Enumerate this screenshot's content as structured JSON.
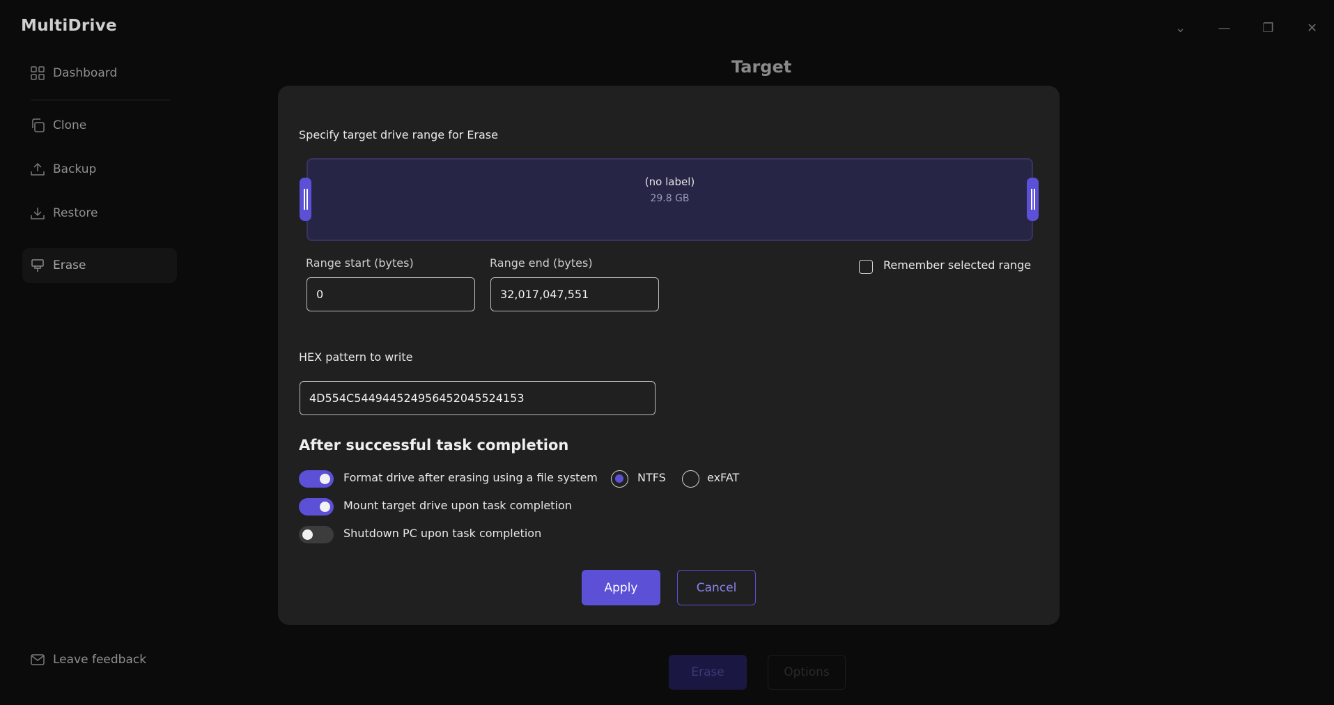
{
  "app": {
    "title": "MultiDrive"
  },
  "window_controls": {
    "dropdown": "⌄",
    "minimize": "—",
    "restore": "❐",
    "close": "✕"
  },
  "sidebar": {
    "items": [
      {
        "label": "Dashboard",
        "icon": "dashboard-icon"
      },
      {
        "label": "Clone",
        "icon": "clone-icon"
      },
      {
        "label": "Backup",
        "icon": "backup-icon"
      },
      {
        "label": "Restore",
        "icon": "restore-icon"
      },
      {
        "label": "Erase",
        "icon": "erase-icon",
        "active": true
      }
    ],
    "feedback_label": "Leave feedback"
  },
  "main": {
    "title": "Target",
    "primary_button": "Erase",
    "secondary_button": "Options"
  },
  "modal": {
    "heading": "Specify target drive range for Erase",
    "drive": {
      "label": "(no label)",
      "size": "29.8 GB"
    },
    "range_start": {
      "label": "Range start (bytes)",
      "value": "0"
    },
    "range_end": {
      "label": "Range end (bytes)",
      "value": "32,017,047,551"
    },
    "remember_range": {
      "label": "Remember selected range",
      "checked": false
    },
    "hex_pattern": {
      "label": "HEX pattern to write",
      "value": "4D554C544944524956452045524153"
    },
    "after_task": {
      "title": "After successful task completion",
      "format_drive": {
        "label": "Format drive after erasing using a file system",
        "enabled": true
      },
      "filesystems": [
        {
          "label": "NTFS",
          "selected": true
        },
        {
          "label": "exFAT",
          "selected": false
        }
      ],
      "mount_drive": {
        "label": "Mount target drive upon task completion",
        "enabled": true
      },
      "shutdown_pc": {
        "label": "Shutdown PC upon task completion",
        "enabled": false
      }
    },
    "apply_label": "Apply",
    "cancel_label": "Cancel"
  },
  "colors": {
    "accent": "#5b50d6",
    "modal_bg": "#202020",
    "overlay_bg": "#0b0b0b",
    "range_fill": "#272546"
  }
}
